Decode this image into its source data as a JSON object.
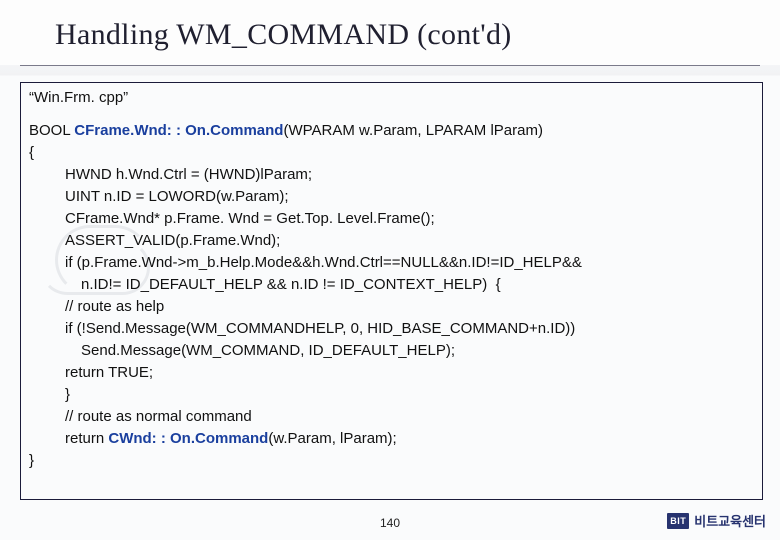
{
  "title": "Handling WM_COMMAND (cont'd)",
  "filename": "“Win.Frm. cpp”",
  "code": {
    "l1a": "BOOL ",
    "l1b": "CFrame.Wnd: : On.Command",
    "l1c": "(WPARAM w.Param, LPARAM lParam)",
    "l2": "{",
    "l3": "HWND h.Wnd.Ctrl = (HWND)lParam;",
    "l4": "UINT n.ID = LOWORD(w.Param);",
    "l5": "CFrame.Wnd* p.Frame. Wnd = Get.Top. Level.Frame();",
    "l6": "ASSERT_VALID(p.Frame.Wnd);",
    "l7": "if (p.Frame.Wnd->m_b.Help.Mode&&h.Wnd.Ctrl==NULL&&n.ID!=ID_HELP&&",
    "l8": "n.ID!= ID_DEFAULT_HELP && n.ID != ID_CONTEXT_HELP)  {",
    "l9": "// route as help",
    "l10": "if (!Send.Message(WM_COMMANDHELP, 0, HID_BASE_COMMAND+n.ID))",
    "l11": "Send.Message(WM_COMMAND, ID_DEFAULT_HELP);",
    "l12": "return TRUE;",
    "l13": "}",
    "l14": "// route as normal command",
    "l15a": "return ",
    "l15b": "CWnd: : On.Command",
    "l15c": "(w.Param, lParam);",
    "l16": "}"
  },
  "page_number": "140",
  "footer": {
    "badge": "BIT",
    "label": "비트교육센터"
  }
}
